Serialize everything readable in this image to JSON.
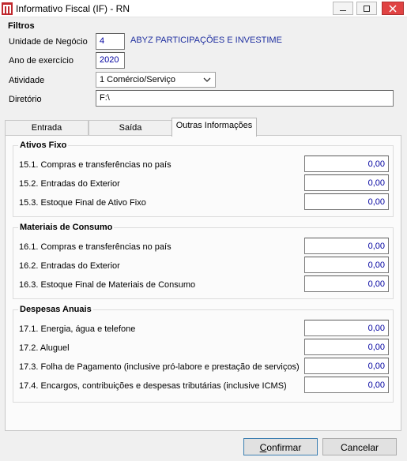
{
  "window": {
    "title": "Informativo Fiscal (IF) - RN"
  },
  "filtros": {
    "heading": "Filtros",
    "unidade_label": "Unidade de Negócio",
    "unidade_value": "4",
    "empresa_nome": "ABYZ PARTICIPAÇÕES E INVESTIME",
    "ano_label": "Ano de exercício",
    "ano_value": "2020",
    "atividade_label": "Atividade",
    "atividade_value": "1 Comércio/Serviço",
    "diretorio_label": "Diretório",
    "diretorio_value": "F:\\"
  },
  "tabs": [
    {
      "label": "Entrada"
    },
    {
      "label": "Saída"
    },
    {
      "label": "Outras Informações"
    }
  ],
  "groups": [
    {
      "title": "Ativos Fixo",
      "rows": [
        {
          "label": "15.1. Compras e transferências no país",
          "value": "0,00"
        },
        {
          "label": "15.2. Entradas do Exterior",
          "value": "0,00"
        },
        {
          "label": "15.3. Estoque Final de Ativo Fixo",
          "value": "0,00"
        }
      ]
    },
    {
      "title": "Materiais de Consumo",
      "rows": [
        {
          "label": "16.1. Compras e transferências no país",
          "value": "0,00"
        },
        {
          "label": "16.2. Entradas do Exterior",
          "value": "0,00"
        },
        {
          "label": "16.3. Estoque Final de Materiais de Consumo",
          "value": "0,00"
        }
      ]
    },
    {
      "title": "Despesas Anuais",
      "rows": [
        {
          "label": "17.1. Energia, água e telefone",
          "value": "0,00"
        },
        {
          "label": "17.2. Aluguel",
          "value": "0,00"
        },
        {
          "label": "17.3. Folha de Pagamento (inclusive pró-labore e prestação de serviços)",
          "value": "0,00"
        },
        {
          "label": "17.4. Encargos, contribuições e despesas tributárias (inclusive ICMS)",
          "value": "0,00"
        }
      ]
    }
  ],
  "buttons": {
    "confirmar_first": "C",
    "confirmar_rest": "onfirmar",
    "cancelar": "Cancelar"
  }
}
